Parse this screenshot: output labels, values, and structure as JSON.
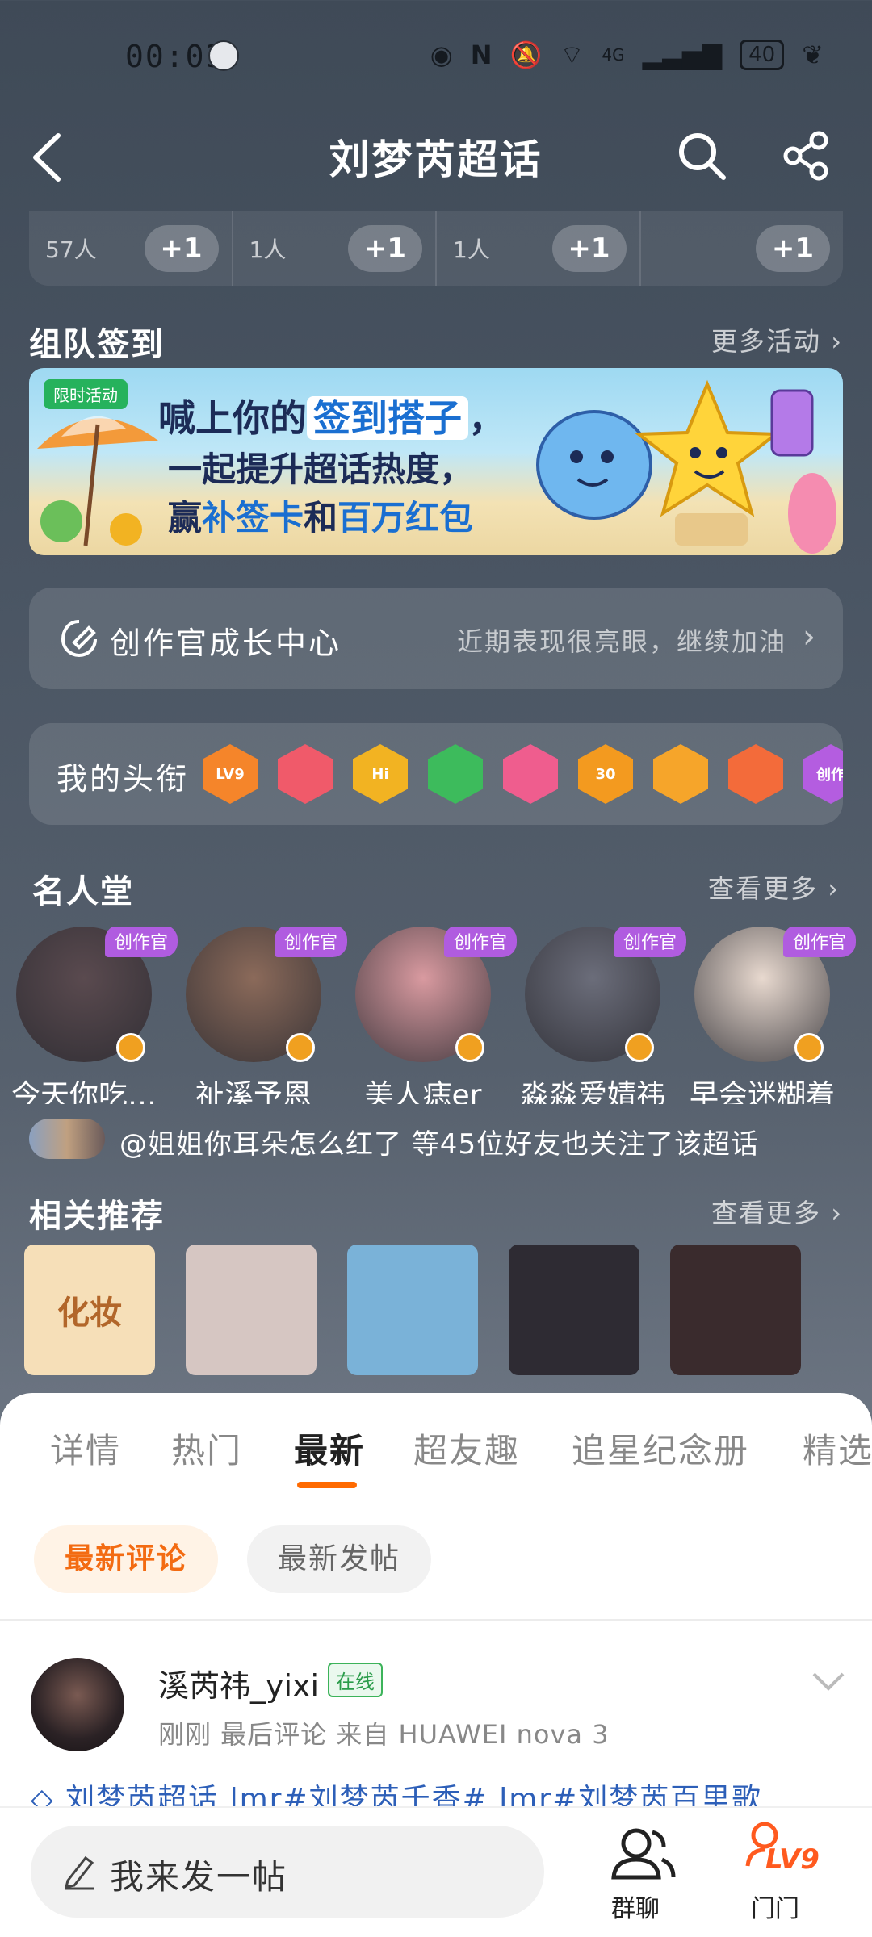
{
  "status_bar": {
    "time": "00:03",
    "network": "4G",
    "battery": "40"
  },
  "header": {
    "title": "刘梦芮超话"
  },
  "strip": [
    {
      "count": "57人",
      "button": "+1"
    },
    {
      "count": "1人",
      "button": "+1"
    },
    {
      "count": "1人",
      "button": "+1"
    },
    {
      "count": "",
      "button": "+1"
    }
  ],
  "team_checkin": {
    "title": "组队签到",
    "more": "更多活动"
  },
  "banner": {
    "tag": "限时活动",
    "line1_pre": "喊上你的",
    "line1_hl": "签到搭子",
    "line1_post": "，",
    "line2": "一起提升超话热度，",
    "line3_pre": "赢",
    "line3_a": "补签卡",
    "line3_mid": "和",
    "line3_b": "百万红包"
  },
  "creator_center": {
    "title": "创作官成长中心",
    "subtitle": "近期表现很亮眼，继续加油"
  },
  "titles_card": {
    "label": "我的头衔",
    "badges": [
      {
        "text": "LV9",
        "color": "#f5852a"
      },
      {
        "text": "",
        "color": "#f05a6a"
      },
      {
        "text": "Hi",
        "color": "#f2b322"
      },
      {
        "text": "",
        "color": "#3dbb5c"
      },
      {
        "text": "",
        "color": "#ef5d8e"
      },
      {
        "text": "30",
        "color": "#f39a1f"
      },
      {
        "text": "",
        "color": "#f6a52a"
      },
      {
        "text": "",
        "color": "#f36b3a"
      },
      {
        "text": "创作",
        "color": "#b45de0"
      }
    ]
  },
  "hall_of_fame": {
    "title": "名人堂",
    "more": "查看更多",
    "tag": "创作官",
    "people": [
      {
        "name": "今天你吃…",
        "color": "#5a4a4f"
      },
      {
        "name": "祉溪予恩",
        "color": "#8b6a5a"
      },
      {
        "name": "美人痣er",
        "color": "#d99aa0"
      },
      {
        "name": "淼淼爱婧祎",
        "color": "#6b6d7a"
      },
      {
        "name": "早会迷糊着",
        "color": "#e8d9cf"
      }
    ]
  },
  "followers": {
    "text": "@姐姐你耳朵怎么红了 等45位好友也关注了该超话"
  },
  "related": {
    "title": "相关推荐",
    "more": "查看更多",
    "items": [
      {
        "label": "化妆",
        "color": "#f6dfb8"
      },
      {
        "label": "",
        "color": "#d6c6c2"
      },
      {
        "label": "",
        "color": "#7ab2d8"
      },
      {
        "label": "",
        "color": "#2e2b33"
      },
      {
        "label": "",
        "color": "#3a2b2d"
      }
    ]
  },
  "tabs": [
    "详情",
    "热门",
    "最新",
    "超友趣",
    "追星纪念册",
    "精选"
  ],
  "active_tab": "最新",
  "filters": {
    "latest_comments": "最新评论",
    "latest_posts": "最新发帖"
  },
  "post": {
    "username": "溪芮祎_yixi",
    "online": "在线",
    "meta": "刚刚 最后评论  来自 HUAWEI nova 3",
    "topic": "刘梦芮超话 lmr#刘梦芮千香# lmr#刘梦芮百里歌"
  },
  "bottom": {
    "compose": "我来发一帖",
    "group_chat": "群聊",
    "level": "LV9",
    "level_label": "门门"
  },
  "colors": {
    "accent": "#ff6a00",
    "link": "#2d5fb8"
  }
}
